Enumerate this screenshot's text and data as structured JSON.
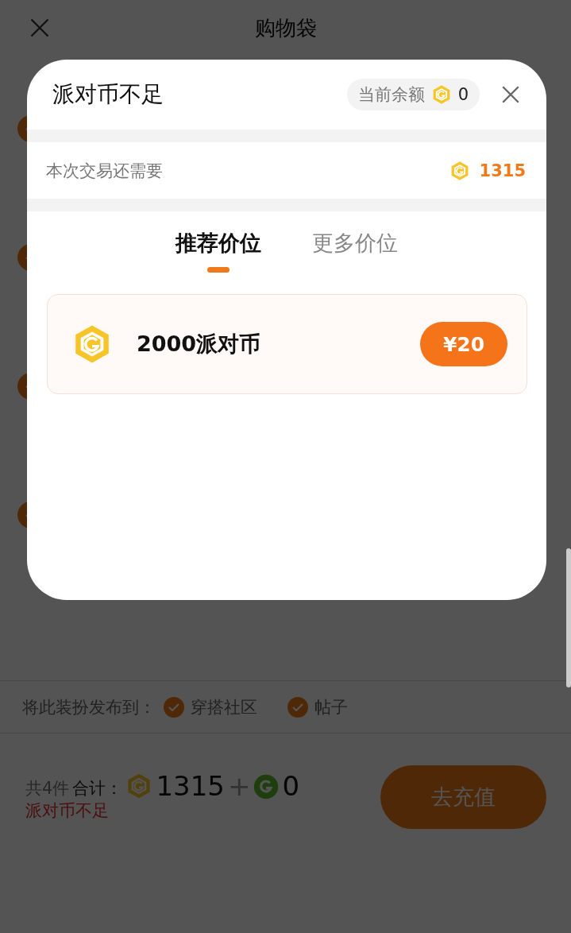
{
  "header": {
    "title": "购物袋"
  },
  "items": [
    {
      "checked": true
    },
    {
      "checked": true
    },
    {
      "checked": true
    },
    {
      "checked": true
    }
  ],
  "publish": {
    "label": "将此装扮发布到：",
    "options": [
      {
        "label": "穿搭社区",
        "checked": true
      },
      {
        "label": "帖子",
        "checked": true
      }
    ]
  },
  "footer": {
    "count": "共4件",
    "total_label": "合计：",
    "gold_amount": "1315",
    "plus": "+",
    "green_amount": "0",
    "warning": "派对币不足",
    "button": "去充值"
  },
  "dialog": {
    "title": "派对币不足",
    "balance_label": "当前余额",
    "balance": "0",
    "need_label": "本次交易还需要",
    "need_amount": "1315",
    "tabs": [
      {
        "label": "推荐价位",
        "selected": true
      },
      {
        "label": "更多价位",
        "selected": false
      }
    ],
    "offers": [
      {
        "name": "2000派对币",
        "price": "¥20"
      }
    ]
  }
}
